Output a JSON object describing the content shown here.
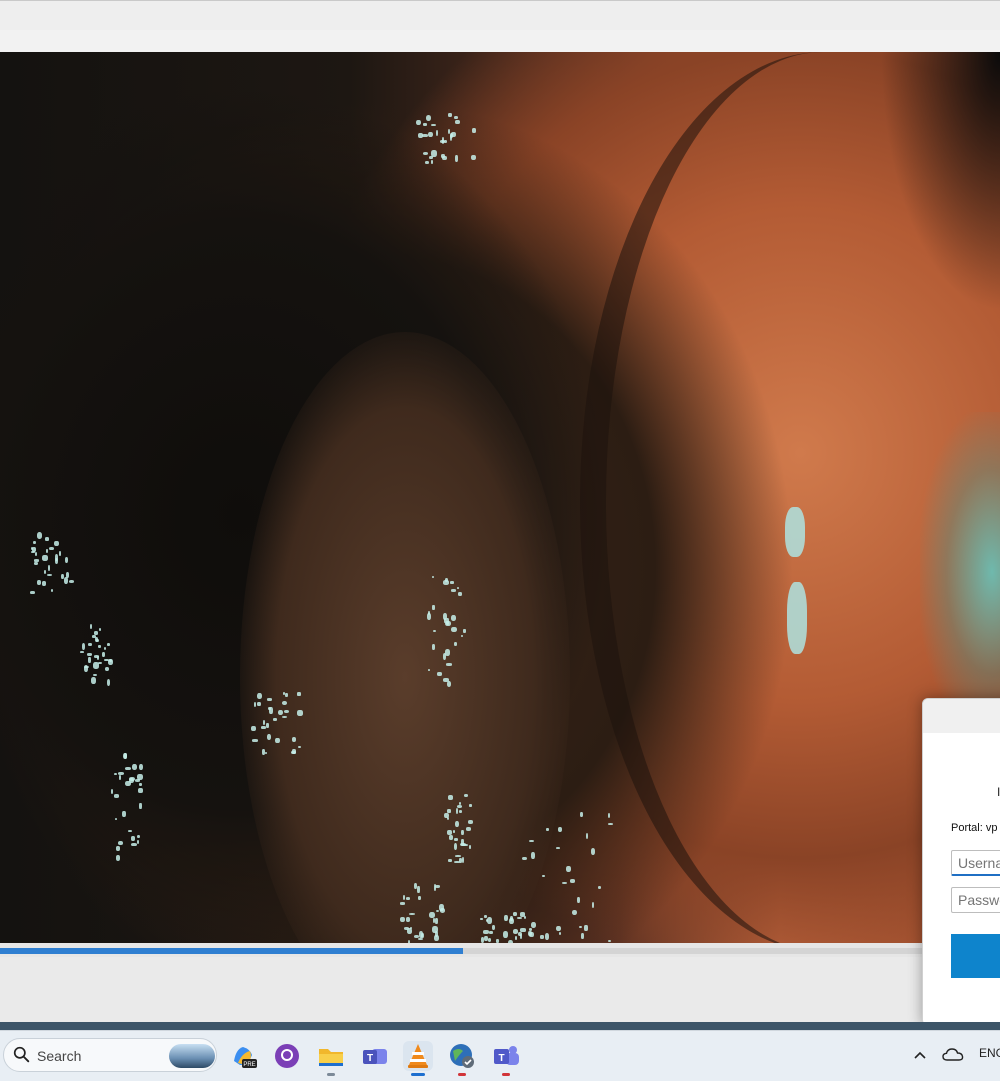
{
  "video": {
    "progress_fraction": 0.463
  },
  "dialog": {
    "portal_label": "Portal: vp",
    "username_placeholder": "Userna",
    "password_placeholder": "Passwo",
    "heading_fragment": "I"
  },
  "taskbar": {
    "search_label": "Search",
    "icons": [
      "copilot-pre-icon",
      "github-desktop-icon",
      "file-explorer-icon",
      "teams-classic-icon",
      "vlc-icon",
      "vpn-globe-icon",
      "teams-icon"
    ],
    "language": "ENG"
  },
  "colors": {
    "accent": "#0e84cc",
    "progress": "#2f7fd1"
  }
}
